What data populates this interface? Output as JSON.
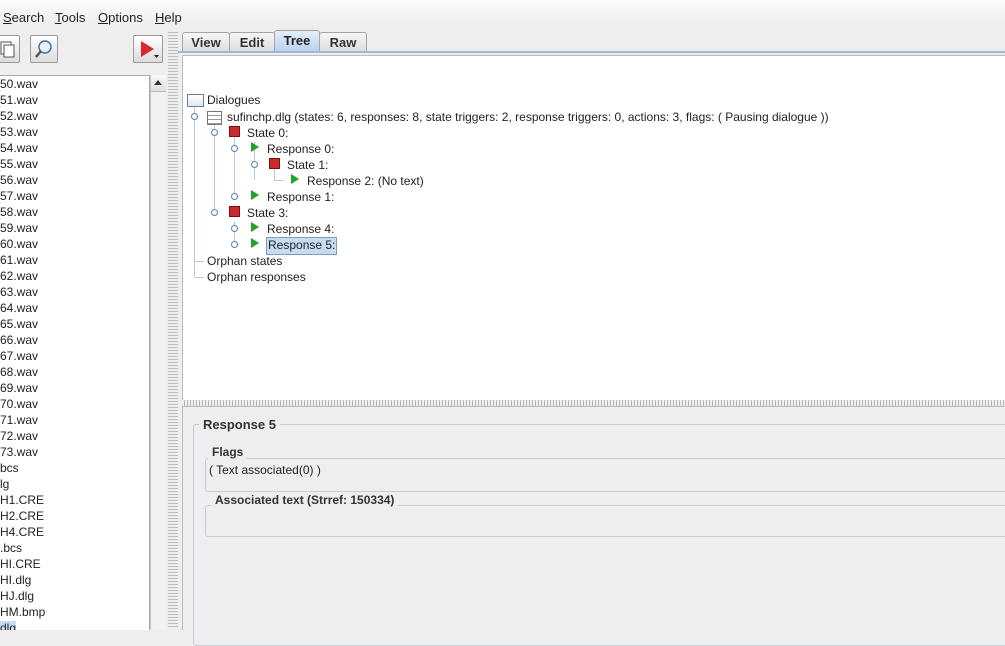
{
  "menu": [
    "Search",
    "Tools",
    "Options",
    "Help"
  ],
  "menu_mnemonics": [
    "S",
    "T",
    "O",
    "H"
  ],
  "toolbar": {
    "copy_icon": "copy-icon",
    "find_icon": "magnifier-icon",
    "play_icon": "play-dropdown-icon",
    "play_color": "#d9282f"
  },
  "files": [
    "50.wav",
    "51.wav",
    "52.wav",
    "53.wav",
    "54.wav",
    "55.wav",
    "56.wav",
    "57.wav",
    "58.wav",
    "59.wav",
    "60.wav",
    "61.wav",
    "62.wav",
    "63.wav",
    "64.wav",
    "65.wav",
    "66.wav",
    "67.wav",
    "68.wav",
    "69.wav",
    "70.wav",
    "71.wav",
    "72.wav",
    "73.wav",
    "bcs",
    "lg",
    "H1.CRE",
    "H2.CRE",
    "H4.CRE",
    ".bcs",
    "HI.CRE",
    "HI.dlg",
    "HJ.dlg",
    "HM.bmp",
    "dlg"
  ],
  "selected_file_index": 34,
  "tabs": [
    "View",
    "Edit",
    "Tree",
    "Raw"
  ],
  "active_tab": "Tree",
  "tree": {
    "root": "Dialogues",
    "dlg": "sufinchp.dlg (states: 6, responses: 8, state triggers: 2, response triggers: 0, actions: 3, flags: ( Pausing dialogue ))",
    "state0": "State 0:",
    "resp0": "Response 0:",
    "state1": "State 1:",
    "resp2": "Response 2: (No text)",
    "resp1": "Response 1:",
    "state3": "State 3:",
    "resp4": "Response 4:",
    "resp5": "Response 5:",
    "orphan_states": "Orphan states",
    "orphan_responses": "Orphan responses"
  },
  "detail": {
    "title": "Response 5",
    "flags_label": "Flags",
    "flags_value": "( Text associated(0) )",
    "assoc_label": "Associated text (Strref: 150334)"
  },
  "colors": {
    "state_icon": "#cc2a2a",
    "response_icon": "#22a028",
    "selection": "#c6dcf3"
  }
}
